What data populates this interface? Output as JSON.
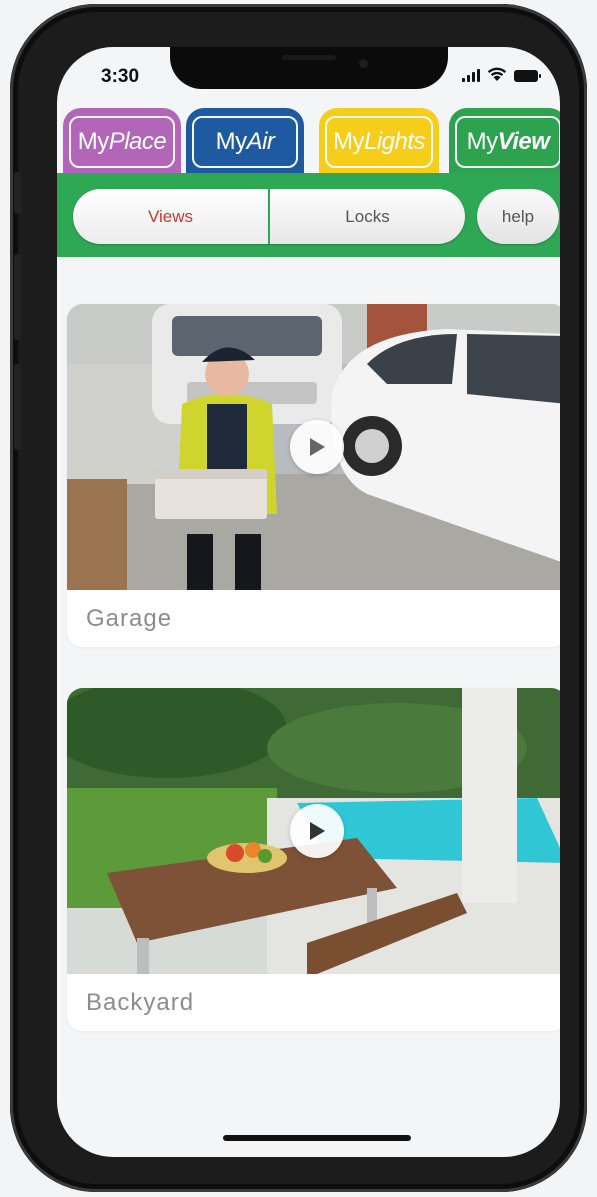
{
  "status": {
    "time": "3:30"
  },
  "tabs": [
    {
      "prefix": "My",
      "name": "Place",
      "color": "#b166b7"
    },
    {
      "prefix": "My",
      "name": "Air",
      "color": "#1e5aa0"
    },
    {
      "prefix": "My",
      "name": "Lights",
      "color": "#f5cd1a"
    },
    {
      "prefix": "My",
      "name": "View",
      "color": "#2da24f"
    }
  ],
  "segments": {
    "views": "Views",
    "locks": "Locks",
    "help": "help"
  },
  "cameras": [
    {
      "label": "Garage"
    },
    {
      "label": "Backyard"
    }
  ],
  "colors": {
    "accent_green": "#2fa856",
    "active_red": "#c8382e"
  }
}
